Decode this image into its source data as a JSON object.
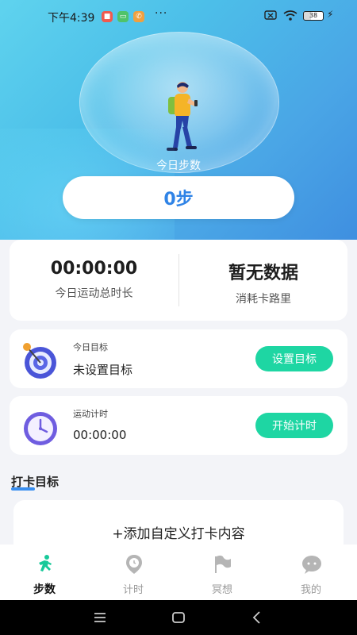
{
  "status_bar": {
    "time": "下午4:39",
    "more": "···",
    "battery": "38"
  },
  "hero": {
    "caption": "今日步数",
    "steps": "0步"
  },
  "summary": {
    "duration_value": "00:00:00",
    "duration_label": "今日运动总时长",
    "calories_value": "暂无数据",
    "calories_label": "消耗卡路里"
  },
  "goal_card": {
    "label": "今日目标",
    "value": "未设置目标",
    "button": "设置目标"
  },
  "timer_card": {
    "label": "运动计时",
    "value": "00:00:00",
    "button": "开始计时"
  },
  "checkin": {
    "title": "打卡目标",
    "add_text": "+添加自定义打卡内容"
  },
  "tabs": [
    {
      "label": "步数",
      "icon": "running-icon",
      "active": true
    },
    {
      "label": "计时",
      "icon": "location-clock-icon",
      "active": false
    },
    {
      "label": "冥想",
      "icon": "flag-icon",
      "active": false
    },
    {
      "label": "我的",
      "icon": "chat-face-icon",
      "active": false
    }
  ],
  "colors": {
    "accent_green": "#1ed6a3",
    "steps_blue": "#2f83e6",
    "hero_start": "#5fd3ee",
    "hero_end": "#3f8fe0"
  }
}
